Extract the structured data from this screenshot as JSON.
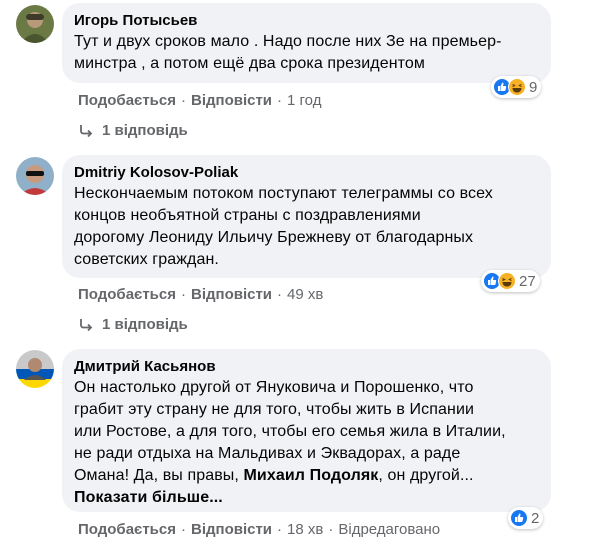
{
  "comments": [
    {
      "author": "Игорь Потысьев",
      "lines": [
        "Тут и двух сроков мало . Надо после них Зе на премьер-",
        "минстра , а потом ещё два срока президентом"
      ],
      "reaction_icons": [
        "like-icon",
        "haha-icon"
      ],
      "reaction_count": "9",
      "like_label": "Подобається",
      "reply_label": "Відповісти",
      "time": "1 год",
      "replies_label": "1 відповідь"
    },
    {
      "author": "Dmitriy Kolosov-Poliak",
      "lines": [
        "Нескончаемым потоком поступают телеграммы со всех",
        "концов необъятной страны с поздравлениями",
        "дорогому Леониду Ильичу Брежневу от благодарных",
        "советских граждан."
      ],
      "reaction_icons": [
        "like-icon",
        "haha-icon"
      ],
      "reaction_count": "27",
      "like_label": "Подобається",
      "reply_label": "Відповісти",
      "time": "49 хв",
      "replies_label": "1 відповідь"
    },
    {
      "author": "Дмитрий Касьянов",
      "lines": [
        "Он настолько другой от Януковича и Порошенко, что",
        "грабит эту страну не для того, чтобы жить в Испании",
        "или Ростове, а для того, чтобы его семья жила в Италии,",
        "не ради отдыха на Мальдивах и Эквадорах, а раде"
      ],
      "last_line_start": "Омана! Да, вы правы, ",
      "mention": "Михаил Подоляк",
      "last_line_end": ", он другой...",
      "see_more": "Показати більше...",
      "reaction_icons": [
        "like-icon"
      ],
      "reaction_count": "2",
      "like_label": "Подобається",
      "reply_label": "Відповісти",
      "time": "18 хв",
      "edited": "Відредаговано"
    }
  ],
  "colors": {
    "bubble": "#f0f2f5",
    "meta": "#65676b",
    "like": "#1877f2",
    "haha": "#f7b125"
  }
}
